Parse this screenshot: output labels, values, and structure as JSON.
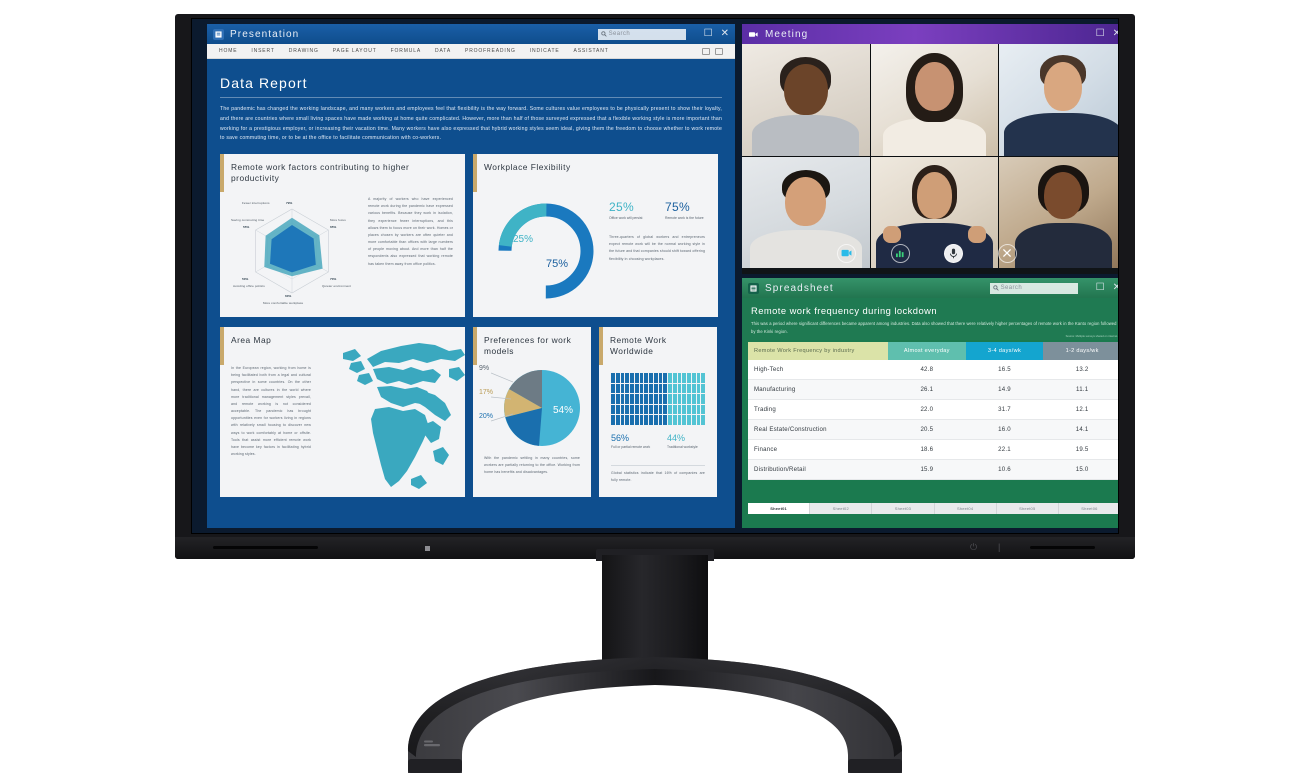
{
  "device": {
    "brand_mark": "monitor-brand-logo"
  },
  "presentation": {
    "app_icon": "presentation-file-icon",
    "title": "Presentation",
    "search_placeholder": "Search",
    "window_buttons": {
      "maximize": "☐",
      "close": "✕"
    },
    "ribbon_tabs": [
      "HOME",
      "INSERT",
      "DRAWING",
      "PAGE LAYOUT",
      "FORMULA",
      "DATA",
      "PROOFREADING",
      "INDICATE",
      "ASSISTANT"
    ],
    "slide": {
      "title": "Data Report",
      "body": "The pandemic has changed the working landscape, and many workers and employees feel that flexibility is the way forward. Some cultures value employees to be physically present to show their loyalty, and there are countries where small living spaces have made working at home quite complicated. However, more than half of those surveyed expressed that a flexible working style is more important than working for a prestigious employer, or increasing their vacation time. Many workers have also expressed that hybrid working styles seem ideal, giving them the freedom to choose whether to work remote to save commuting time, or to be at the office to facilitate communication with co-workers."
    },
    "card_radar": {
      "title": "Remote work factors contributing to higher productivity",
      "text": "A majority of workers who have experienced remote work during the pandemic have expressed various benefits. Because they work in isolation, they experience fewer interruptions, and this allows them to focus more on their work. Homes or places chosen by workers are often quieter and more comfortable than offices with large numbers of people moving about. And more than half the respondents also expressed that working remote has taken them away from office politics."
    },
    "card_flex": {
      "title": "Workplace Flexibility",
      "stat_a_value": "25%",
      "stat_a_caption": "Office work will persist",
      "stat_b_value": "75%",
      "stat_b_caption": "Remote work is the future",
      "text": "Three-quarters of global workers and entrepreneurs expect remote work will be the normal working style in the future and that companies should shift toward offering flexibility in choosing workplaces.",
      "donut_label_small": "25%",
      "donut_label_large": "75%"
    },
    "card_map": {
      "title": "Area Map",
      "text": "In the European region, working from home is being facilitated both from a legal and cultural perspective in some countries. On the other hand, there are cultures in the world where more traditional management styles prevail, and remote working is not considered acceptable. The pandemic has brought opportunities even for workers living in regions with relatively small housing to discover new ways to work comfortably at home or offsite. Tools that assist more efficient remote work have become key factors in facilitating hybrid working styles."
    },
    "card_pie": {
      "title": "Preferences for work models",
      "text": "With the pandemic settling in many countries, some workers are partially returning to the office. Working from home has benefits and disadvantages."
    },
    "card_dots": {
      "title": "Remote Work Worldwide",
      "stat_a_value": "56%",
      "stat_a_caption": "Full or partial remote work",
      "stat_b_value": "44%",
      "stat_b_caption": "Traditional workstyle",
      "text": "Global statistics indicate that 16% of companies are fully remote."
    }
  },
  "meeting": {
    "app_icon": "video-camera-icon",
    "title": "Meeting",
    "window_buttons": {
      "maximize": "☐",
      "close": "✕"
    },
    "controls": [
      "share-screen-icon",
      "activity-icon",
      "microphone-icon",
      "end-call-icon"
    ],
    "participants": [
      {
        "name": "participant-1"
      },
      {
        "name": "participant-2"
      },
      {
        "name": "participant-3"
      },
      {
        "name": "participant-4"
      },
      {
        "name": "participant-5"
      },
      {
        "name": "participant-6"
      }
    ]
  },
  "spreadsheet": {
    "app_icon": "spreadsheet-file-icon",
    "title": "Spreadsheet",
    "search_placeholder": "Search",
    "window_buttons": {
      "maximize": "☐",
      "close": "✕"
    },
    "heading": "Remote work frequency during lockdown",
    "subheading": "This was a period where significant differences became apparent among industries. Data also showed that there were relatively higher percentages of remote work in the Kanto region followed by the Kinki region.",
    "source": "Source: Multiple surveys shared on internet.",
    "sheet_tabs": [
      "Sheet01",
      "Sheet02",
      "Sheet03",
      "Sheet04",
      "Sheet05",
      "Sheet06"
    ],
    "active_tab": "Sheet01"
  },
  "chart_data": [
    {
      "type": "radar",
      "title": "Remote work factors contributing to higher productivity",
      "categories": [
        "Fewer interruptions",
        "More focus",
        "Quieter environment",
        "More comfortable workplace",
        "Avoiding office politics",
        "Saving commuting time"
      ],
      "values": [
        79,
        65,
        70,
        60,
        50,
        55
      ],
      "unit": "%",
      "tick_labels": [
        "79%",
        "65%",
        "70%",
        "60%",
        "50%",
        "55%"
      ],
      "rmax": 100,
      "grid": true,
      "legend": "none"
    },
    {
      "type": "pie",
      "title": "Workplace Flexibility",
      "subtitle": "donut",
      "categories": [
        "Remote work is the future",
        "Office work will persist"
      ],
      "values": [
        75,
        25
      ],
      "labels": [
        "75%",
        "25%"
      ],
      "colors": [
        "#1a79bf",
        "#3fb3c6"
      ],
      "legend": "none"
    },
    {
      "type": "pie",
      "title": "Preferences for work models",
      "categories": [
        "54%",
        "20%",
        "17%",
        "9%"
      ],
      "values": [
        54,
        20,
        17,
        9
      ],
      "labels": [
        "54%",
        "20%",
        "17%",
        "9%"
      ],
      "colors": [
        "#45b4d4",
        "#1a6fae",
        "#d2b472",
        "#6d7b85"
      ],
      "legend": "none"
    },
    {
      "type": "bar",
      "subtype": "waffle-dot-matrix",
      "title": "Remote Work Worldwide",
      "categories": [
        "Full or partial remote work",
        "Traditional workstyle"
      ],
      "values": [
        56,
        44
      ],
      "labels": [
        "56%",
        "44%"
      ],
      "colors": [
        "#1a6fae",
        "#53c4d4"
      ],
      "ylabel": "",
      "xlabel": "",
      "grid": false,
      "legend": "bottom"
    },
    {
      "type": "table",
      "title": "Remote work frequency during lockdown",
      "columns": [
        "Remote Work Frequency by industry",
        "Almost everyday",
        "3-4 days/wk",
        "1-2 days/wk"
      ],
      "rows": [
        [
          "High-Tech",
          "42.8",
          "16.5",
          "13.2"
        ],
        [
          "Manufacturing",
          "26.1",
          "14.9",
          "11.1"
        ],
        [
          "Trading",
          "22.0",
          "31.7",
          "12.1"
        ],
        [
          "Real Estate/Construction",
          "20.5",
          "16.0",
          "14.1"
        ],
        [
          "Finance",
          "18.6",
          "22.1",
          "19.5"
        ],
        [
          "Distribution/Retail",
          "15.9",
          "10.6",
          "15.0"
        ]
      ]
    }
  ]
}
